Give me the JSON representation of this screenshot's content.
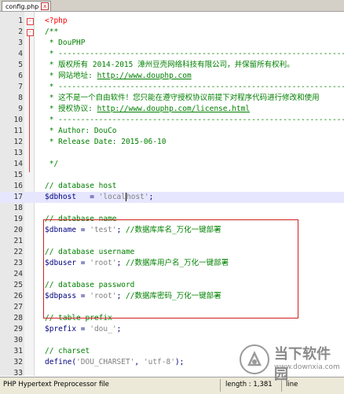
{
  "tab": {
    "filename": "config.php",
    "close_label": "x"
  },
  "code": {
    "lines": [
      {
        "n": "1",
        "text": "<?php",
        "cls": "c-tag"
      },
      {
        "n": "2",
        "text": "/**",
        "cls": "c-com"
      },
      {
        "n": "3",
        "text": " * DouPHP",
        "cls": "c-com"
      },
      {
        "n": "4",
        "text": " * --------------------------------------------------------------------------------",
        "cls": "c-com"
      },
      {
        "n": "5",
        "text": " * 版权所有 2014-2015 漳州豆壳网络科技有限公司，并保留所有权利。",
        "cls": "c-com"
      },
      {
        "n": "6",
        "text": " * 网站地址: ",
        "cls": "c-com",
        "link": "http://www.douphp.com"
      },
      {
        "n": "7",
        "text": " * --------------------------------------------------------------------------------",
        "cls": "c-com"
      },
      {
        "n": "8",
        "text": " * 这不是一个自由软件！您只能在遵守授权协议前提下对程序代码进行修改和使用",
        "cls": "c-com"
      },
      {
        "n": "9",
        "text": " * 授权协议: ",
        "cls": "c-com",
        "link": "http://www.douphp.com/license.html"
      },
      {
        "n": "10",
        "text": " * --------------------------------------------------------------------------------",
        "cls": "c-com"
      },
      {
        "n": "11",
        "text": " * Author: DouCo",
        "cls": "c-com"
      },
      {
        "n": "12",
        "text": " * Release Date: 2015-06-10",
        "cls": "c-com"
      },
      {
        "n": "13",
        "text": "",
        "cls": "c-com"
      },
      {
        "n": "14",
        "text": " */",
        "cls": "c-com"
      },
      {
        "n": "15",
        "text": "",
        "cls": ""
      },
      {
        "n": "16",
        "text": "// database host",
        "cls": "c-com"
      },
      {
        "n": "17",
        "var": "$dbhost",
        "pad": "   ",
        "str_a": "'local",
        "str_b": "host'",
        "tail": ";",
        "current": true
      },
      {
        "n": "18",
        "text": "",
        "cls": ""
      },
      {
        "n": "19",
        "text": "// database name",
        "cls": "c-com"
      },
      {
        "n": "20",
        "var": "$dbname",
        "pad": " ",
        "str_a": "'test'",
        "tail": "; ",
        "zh": "//数据库库名_万化一键部署"
      },
      {
        "n": "21",
        "text": "",
        "cls": ""
      },
      {
        "n": "22",
        "text": "// database username",
        "cls": "c-com"
      },
      {
        "n": "23",
        "var": "$dbuser",
        "pad": " ",
        "str_a": "'root'",
        "tail": "; ",
        "zh": "//数据库用户名_万化一键部署"
      },
      {
        "n": "24",
        "text": "",
        "cls": ""
      },
      {
        "n": "25",
        "text": "// database password",
        "cls": "c-com"
      },
      {
        "n": "26",
        "var": "$dbpass",
        "pad": " ",
        "str_a": "'root'",
        "tail": "; ",
        "zh": "//数据库密码_万化一键部署"
      },
      {
        "n": "27",
        "text": "",
        "cls": ""
      },
      {
        "n": "28",
        "text": "// table prefix",
        "cls": "c-com"
      },
      {
        "n": "29",
        "var": "$prefix",
        "pad": " ",
        "str_a": "'dou_'",
        "tail": ";"
      },
      {
        "n": "30",
        "text": "",
        "cls": ""
      },
      {
        "n": "31",
        "text": "// charset",
        "cls": "c-com"
      },
      {
        "n": "32",
        "fn": "define",
        "args_a": "(",
        "str_a": "'DOU_CHARSET'",
        "mid": ", ",
        "str_b": "'utf-8'",
        "tail": ");"
      },
      {
        "n": "33",
        "text": "",
        "cls": ""
      }
    ]
  },
  "status": {
    "file_type": "PHP Hypertext Preprocessor file",
    "length": "length : 1,381",
    "lines": "line"
  },
  "watermark": {
    "brand": "当下软件园",
    "url": "www.downxia.com"
  }
}
